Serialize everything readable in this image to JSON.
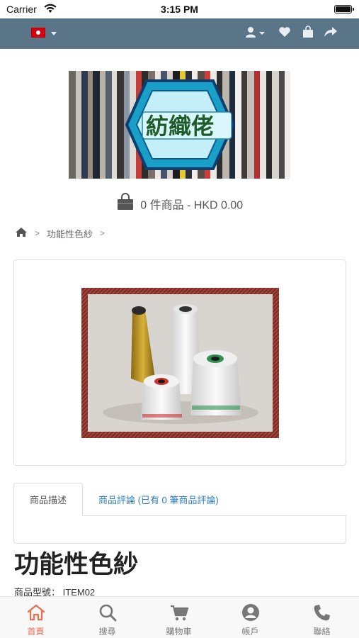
{
  "status_bar": {
    "carrier": "Carrier",
    "time": "3:15 PM"
  },
  "top_nav": {
    "language_flag": "hong-kong-flag-icon",
    "icons": [
      "user-icon",
      "heart-icon",
      "shopping-bag-icon",
      "share-icon"
    ],
    "background_color": "#5b7588"
  },
  "logo": {
    "text": "紡織佬"
  },
  "cart": {
    "summary": "0 件商品 - HKD 0.00"
  },
  "breadcrumb": {
    "home_icon": "home-icon",
    "category": "功能性色紗"
  },
  "product_tabs": {
    "description": "商品描述",
    "reviews": "商品評論 (已有 0 筆商品評論)"
  },
  "product": {
    "title": "功能性色紗",
    "model_label": "商品型號：",
    "model_value": "ITEM02"
  },
  "tab_bar": {
    "accent_color": "#ef6b52",
    "items": [
      {
        "label": "首頁",
        "icon": "home-icon",
        "active": true
      },
      {
        "label": "搜尋",
        "icon": "search-icon",
        "active": false
      },
      {
        "label": "購物車",
        "icon": "cart-icon",
        "active": false
      },
      {
        "label": "帳戶",
        "icon": "account-icon",
        "active": false
      },
      {
        "label": "聯絡",
        "icon": "phone-icon",
        "active": false
      }
    ]
  }
}
